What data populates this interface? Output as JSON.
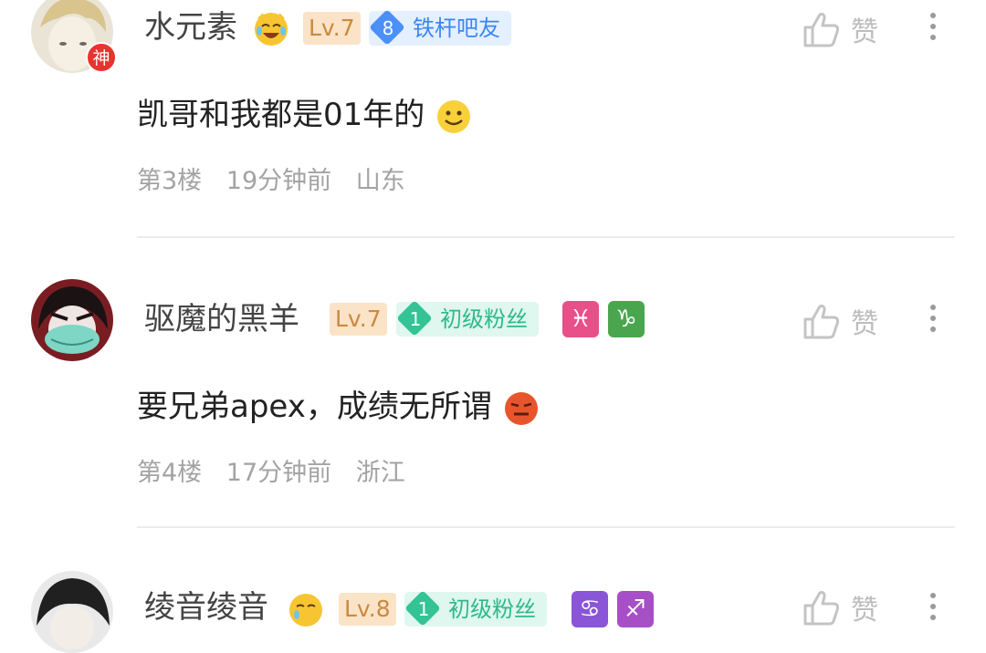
{
  "posts": [
    {
      "username": "水元素",
      "level": "Lv.7",
      "avatar_badge": "神",
      "tag": {
        "number": "8",
        "label": "铁杆吧友",
        "color": "#4c8ff7"
      },
      "zodiac": [],
      "content": "凯哥和我都是01年的",
      "content_emoji": "smile-emoji",
      "floor": "第3楼",
      "time": "19分钟前",
      "location": "山东",
      "like_label": "赞"
    },
    {
      "username": "驱魔的黑羊",
      "level": "Lv.7",
      "tag": {
        "number": "1",
        "label": "初级粉丝",
        "color": "#34c394"
      },
      "zodiac": [
        {
          "symbol": "♓",
          "color": "#e8508a",
          "icon": "pisces-icon"
        },
        {
          "symbol": "♑",
          "color": "#4aa64e",
          "icon": "capricorn-icon"
        }
      ],
      "content": "要兄弟apex，成绩无所谓",
      "content_emoji": "smirk-emoji",
      "floor": "第4楼",
      "time": "17分钟前",
      "location": "浙江",
      "like_label": "赞"
    },
    {
      "username": "绫音绫音",
      "level": "Lv.8",
      "tag": {
        "number": "1",
        "label": "初级粉丝",
        "color": "#34c394"
      },
      "zodiac": [
        {
          "symbol": "♋",
          "color": "#8a55d6",
          "icon": "cancer-icon"
        },
        {
          "symbol": "♐",
          "color": "#a64fc6",
          "icon": "sagittarius-icon"
        }
      ],
      "like_label": "赞"
    }
  ]
}
